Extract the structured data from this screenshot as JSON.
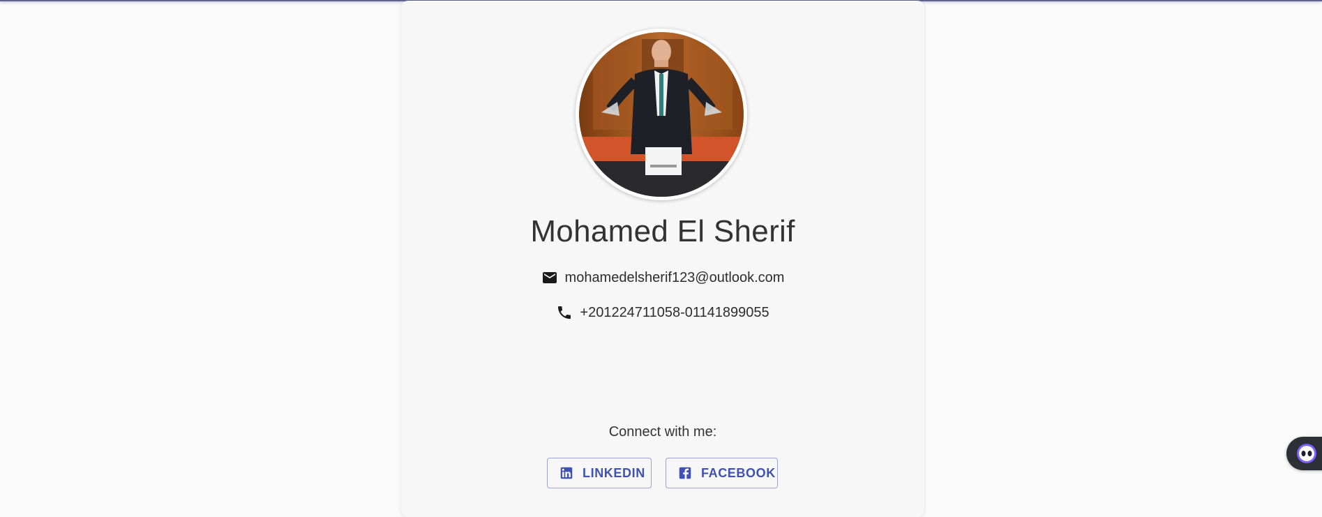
{
  "profile": {
    "name": "Mohamed El Sherif",
    "email": "mohamedelsherif123@outlook.com",
    "phone": "+201224711058-01141899055",
    "photo_icon": "profile-photo"
  },
  "social": {
    "heading": "Connect with me:",
    "buttons": [
      {
        "label": "LINKEDIN",
        "icon": "linkedin-icon"
      },
      {
        "label": "FACEBOOK",
        "icon": "facebook-icon"
      }
    ]
  },
  "icons": {
    "email": "email-icon",
    "phone": "phone-icon",
    "chat": "chatbot-icon"
  },
  "colors": {
    "accent": "#3f51b5",
    "background": "#fafafa",
    "card": "#f7f7f7",
    "text": "#333333"
  }
}
